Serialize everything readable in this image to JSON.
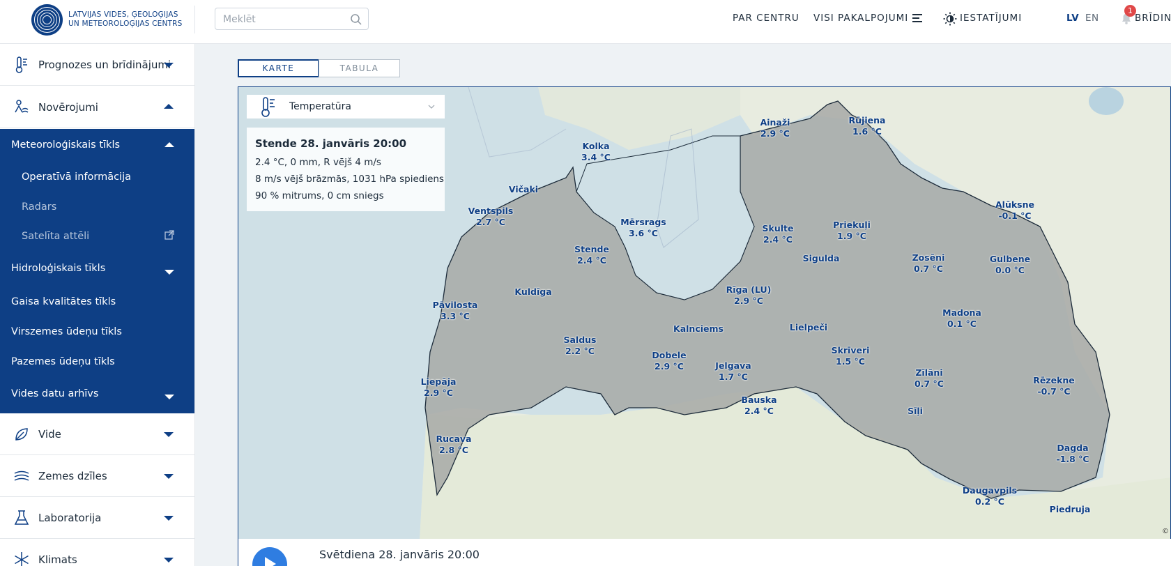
{
  "header": {
    "logo_line1": "LATVIJAS VIDES, ĢEOLOĢIJAS",
    "logo_line2": "UN METEOROLOĢIJAS CENTRS",
    "search_placeholder": "Meklēt",
    "nav": {
      "about": "PAR CENTRU",
      "services": "VISI PAKALPOJUMI",
      "settings": "IESTATĪJUMI"
    },
    "lang_lv": "LV",
    "lang_en": "EN",
    "notification_count": "1",
    "warnings_label": "BRĪDINĀ"
  },
  "sidebar": {
    "items": [
      {
        "label": "Prognozes un brīdinājumi"
      },
      {
        "label": "Novērojumi"
      },
      {
        "label": "Vide"
      },
      {
        "label": "Zemes dzīles"
      },
      {
        "label": "Laboratorija"
      },
      {
        "label": "Klimats"
      }
    ],
    "sub": {
      "meteo": "Meteoroloģiskais tīkls",
      "operative": "Operatīvā informācija",
      "radar": "Radars",
      "satellite": "Satelīta attēli",
      "hydro": "Hidroloģiskais tīkls",
      "air": "Gaisa kvalitātes tīkls",
      "surface": "Virszemes ūdeņu tīkls",
      "ground": "Pazemes ūdeņu tīkls",
      "archive": "Vides datu arhīvs"
    }
  },
  "tabs": {
    "map": "KARTE",
    "table": "TABULA"
  },
  "map": {
    "parameter": "Temperatūra",
    "info": {
      "title": "Stende 28. janvāris 20:00",
      "line1": "2.4 °C, 0 mm, R vējš 4 m/s",
      "line2": "8 m/s vējš brāzmās, 1031 hPa spiediens",
      "line3": "90 % mitrums, 0 cm sniegs"
    },
    "copyright": "©",
    "stations": [
      {
        "name": "Ainaži",
        "temp": "2.9 °C"
      },
      {
        "name": "Rūjiena",
        "temp": "1.6 °C"
      },
      {
        "name": "Kolka",
        "temp": "3.4 °C"
      },
      {
        "name": "Vičaki",
        "temp": ""
      },
      {
        "name": "Ventspils",
        "temp": "2.7 °C"
      },
      {
        "name": "Mērsrags",
        "temp": "3.6 °C"
      },
      {
        "name": "Skulte",
        "temp": "2.4 °C"
      },
      {
        "name": "Priekuļi",
        "temp": "1.9 °C"
      },
      {
        "name": "Alūksne",
        "temp": "-0.1 °C"
      },
      {
        "name": "Stende",
        "temp": "2.4 °C"
      },
      {
        "name": "Sigulda",
        "temp": ""
      },
      {
        "name": "Zosēni",
        "temp": "0.7 °C"
      },
      {
        "name": "Gulbene",
        "temp": "0.0 °C"
      },
      {
        "name": "Kuldīga",
        "temp": ""
      },
      {
        "name": "Rīga (LU)",
        "temp": "2.9 °C"
      },
      {
        "name": "Pāvilosta",
        "temp": "3.3 °C"
      },
      {
        "name": "Madona",
        "temp": "0.1 °C"
      },
      {
        "name": "Kalnciems",
        "temp": ""
      },
      {
        "name": "Lielpeči",
        "temp": ""
      },
      {
        "name": "Saldus",
        "temp": "2.2 °C"
      },
      {
        "name": "Skrīveri",
        "temp": "1.5 °C"
      },
      {
        "name": "Dobele",
        "temp": "2.9 °C"
      },
      {
        "name": "Jelgava",
        "temp": "1.7 °C"
      },
      {
        "name": "Zīlāni",
        "temp": "0.7 °C"
      },
      {
        "name": "Rēzekne",
        "temp": "-0.7 °C"
      },
      {
        "name": "Liepāja",
        "temp": "2.9 °C"
      },
      {
        "name": "Bauska",
        "temp": "2.4 °C"
      },
      {
        "name": "Sīļi",
        "temp": ""
      },
      {
        "name": "Rucava",
        "temp": "2.8 °C"
      },
      {
        "name": "Dagda",
        "temp": "-1.8 °C"
      },
      {
        "name": "Daugavpils",
        "temp": "0.2 °C"
      },
      {
        "name": "Piedruja",
        "temp": ""
      }
    ]
  },
  "timeline": {
    "label": "Svētdiena 28. janvāris 20:00"
  },
  "colors": {
    "brand": "#0e3f85",
    "accent": "#2f7de1",
    "badge": "#e04848"
  }
}
